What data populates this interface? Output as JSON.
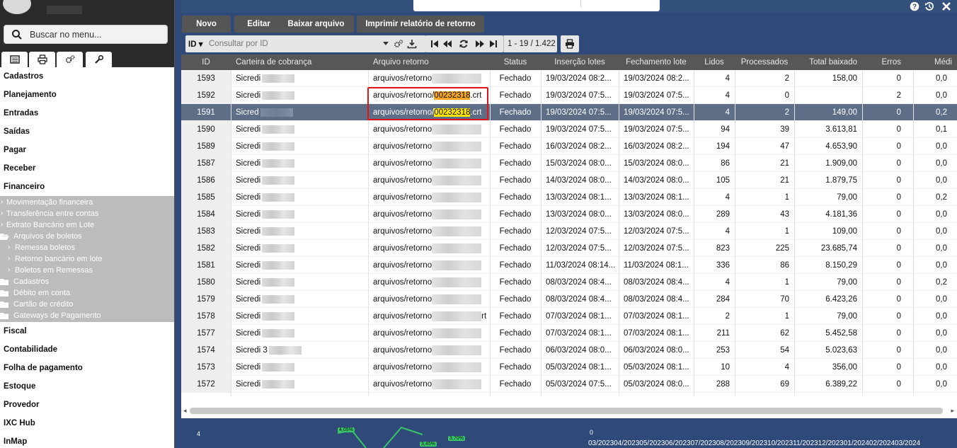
{
  "sidebar": {
    "search_placeholder": "Buscar no menu...",
    "tabs": [
      "list-icon",
      "print-icon",
      "cogs-icon",
      "wrench-icon"
    ],
    "menu_top": [
      "Cadastros",
      "Planejamento",
      "Entradas",
      "Saídas",
      "Pagar",
      "Receber",
      "Financeiro"
    ],
    "financeiro_sub": [
      {
        "label": "Movimentação financeira",
        "level": 1,
        "kind": "caret"
      },
      {
        "label": "Transferência entre contas",
        "level": 1,
        "kind": "caret"
      },
      {
        "label": "Extrato Bancário em Lote",
        "level": 1,
        "kind": "caret"
      },
      {
        "label": "Arquivos de boletos",
        "level": 1,
        "kind": "folder-open"
      },
      {
        "label": "Remessa boletos",
        "level": 2,
        "kind": "caret"
      },
      {
        "label": "Retorno bancário em lote",
        "level": 2,
        "kind": "caret"
      },
      {
        "label": "Boletos em Remessas",
        "level": 2,
        "kind": "caret"
      },
      {
        "label": "Cadastros",
        "level": 1,
        "kind": "folder"
      },
      {
        "label": "Débito em conta",
        "level": 1,
        "kind": "folder"
      },
      {
        "label": "Cartão de crédito",
        "level": 1,
        "kind": "folder"
      },
      {
        "label": "Gateways de Pagamento",
        "level": 1,
        "kind": "folder"
      }
    ],
    "menu_bottom": [
      "Fiscal",
      "Contabilidade",
      "Folha de pagamento",
      "Estoque",
      "Provedor",
      "IXC Hub",
      "InMap"
    ]
  },
  "toolbar": {
    "novo": "Novo",
    "editar": "Editar",
    "baixar": "Baixar arquivo",
    "imprimir": "Imprimir relatório de retorno"
  },
  "filter": {
    "field": "ID",
    "placeholder": "Consultar por ID",
    "page_info": "1 - 19 / 1.422"
  },
  "columns": [
    "ID",
    "Carteira de cobrança",
    "Arquivo retorno",
    "Status",
    "Inserção lotes",
    "Fechamento lote",
    "Lidos",
    "Processados",
    "Total baixado",
    "Erros",
    "Médi"
  ],
  "rows": [
    {
      "id": "1593",
      "carteira": "Sicredi",
      "arquivo": "arquivos/retorno",
      "file": "",
      "ext": "",
      "status": "Fechado",
      "insercao": "19/03/2024 08:2...",
      "fechamento": "19/03/2024 08:2...",
      "lidos": "4",
      "processados": "2",
      "total": "158,00",
      "erros": "0",
      "media": "0,0"
    },
    {
      "id": "1592",
      "carteira": "Sicredi",
      "arquivo": "arquivos/retorno/",
      "file": "00232318",
      "ext": ".crt",
      "status": "Fechado",
      "insercao": "19/03/2024 07:5...",
      "fechamento": "19/03/2024 07:5...",
      "lidos": "4",
      "processados": "0",
      "total": "",
      "erros": "2",
      "media": "0,0"
    },
    {
      "id": "1591",
      "carteira": "Sicred",
      "arquivo": "arquivos/retorno/",
      "file": "00232318",
      "ext": ".crt",
      "status": "Fechado",
      "insercao": "19/03/2024 07:5...",
      "fechamento": "19/03/2024 07:5...",
      "lidos": "4",
      "processados": "2",
      "total": "149,00",
      "erros": "0",
      "media": "0,2"
    },
    {
      "id": "1590",
      "carteira": "Sicredi",
      "arquivo": "arquivos/retorno",
      "file": "",
      "ext": "",
      "status": "Fechado",
      "insercao": "19/03/2024 07:5...",
      "fechamento": "19/03/2024 07:5...",
      "lidos": "94",
      "processados": "39",
      "total": "3.613,81",
      "erros": "0",
      "media": "0,1"
    },
    {
      "id": "1589",
      "carteira": "Sicredi",
      "arquivo": "arquivos/retorno",
      "file": "",
      "ext": "",
      "status": "Fechado",
      "insercao": "16/03/2024 08:2...",
      "fechamento": "16/03/2024 08:2...",
      "lidos": "194",
      "processados": "47",
      "total": "4.653,90",
      "erros": "0",
      "media": "0,0"
    },
    {
      "id": "1587",
      "carteira": "Sicredi",
      "arquivo": "arquivos/retorno",
      "file": "",
      "ext": "",
      "status": "Fechado",
      "insercao": "15/03/2024 08:0...",
      "fechamento": "15/03/2024 08:0...",
      "lidos": "86",
      "processados": "21",
      "total": "1.909,00",
      "erros": "0",
      "media": "0,0"
    },
    {
      "id": "1586",
      "carteira": "Sicredi",
      "arquivo": "arquivos/retorno",
      "file": "",
      "ext": "",
      "status": "Fechado",
      "insercao": "14/03/2024 08:0...",
      "fechamento": "14/03/2024 08:0...",
      "lidos": "105",
      "processados": "21",
      "total": "1.879,75",
      "erros": "0",
      "media": "0,0"
    },
    {
      "id": "1585",
      "carteira": "Sicredi",
      "arquivo": "arquivos/retorno",
      "file": "",
      "ext": "",
      "status": "Fechado",
      "insercao": "13/03/2024 08:1...",
      "fechamento": "13/03/2024 08:1...",
      "lidos": "4",
      "processados": "1",
      "total": "79,00",
      "erros": "0",
      "media": "0,2"
    },
    {
      "id": "1584",
      "carteira": "Sicredi",
      "arquivo": "arquivos/retorno",
      "file": "",
      "ext": "",
      "status": "Fechado",
      "insercao": "13/03/2024 08:0...",
      "fechamento": "13/03/2024 08:0...",
      "lidos": "289",
      "processados": "43",
      "total": "4.181,36",
      "erros": "0",
      "media": "0,0"
    },
    {
      "id": "1583",
      "carteira": "Sicredi",
      "arquivo": "arquivos/retorno",
      "file": "",
      "ext": "",
      "status": "Fechado",
      "insercao": "12/03/2024 07:5...",
      "fechamento": "12/03/2024 07:5...",
      "lidos": "4",
      "processados": "1",
      "total": "109,00",
      "erros": "0",
      "media": "0,0"
    },
    {
      "id": "1582",
      "carteira": "Sicredi",
      "arquivo": "arquivos/retorno",
      "file": "",
      "ext": "",
      "status": "Fechado",
      "insercao": "12/03/2024 07:5...",
      "fechamento": "12/03/2024 07:5...",
      "lidos": "823",
      "processados": "225",
      "total": "23.685,74",
      "erros": "0",
      "media": "0,0"
    },
    {
      "id": "1581",
      "carteira": "Sicredi",
      "arquivo": "arquivos/retorno",
      "file": "",
      "ext": "",
      "status": "Fechado",
      "insercao": "11/03/2024 08:14...",
      "fechamento": "11/03/2024 08:1...",
      "lidos": "336",
      "processados": "86",
      "total": "8.150,29",
      "erros": "0",
      "media": "0,0"
    },
    {
      "id": "1580",
      "carteira": "Sicredi",
      "arquivo": "arquivos/retorno",
      "file": "",
      "ext": "",
      "status": "Fechado",
      "insercao": "08/03/2024 08:4...",
      "fechamento": "08/03/2024 08:4...",
      "lidos": "4",
      "processados": "1",
      "total": "79,00",
      "erros": "0",
      "media": "0,2"
    },
    {
      "id": "1579",
      "carteira": "Sicredi",
      "arquivo": "arquivos/retorno",
      "file": "",
      "ext": "",
      "status": "Fechado",
      "insercao": "08/03/2024 08:4...",
      "fechamento": "08/03/2024 08:4...",
      "lidos": "284",
      "processados": "70",
      "total": "6.423,26",
      "erros": "0",
      "media": "0,0"
    },
    {
      "id": "1578",
      "carteira": "Sicredi",
      "arquivo": "arquivos/retorno",
      "file": "",
      "ext": "rt",
      "status": "Fechado",
      "insercao": "07/03/2024 08:1...",
      "fechamento": "07/03/2024 08:1...",
      "lidos": "2",
      "processados": "1",
      "total": "79,00",
      "erros": "0",
      "media": "0,0"
    },
    {
      "id": "1577",
      "carteira": "Sicredi",
      "arquivo": "arquivos/retorno",
      "file": "",
      "ext": "",
      "status": "Fechado",
      "insercao": "07/03/2024 08:1...",
      "fechamento": "07/03/2024 08:1...",
      "lidos": "211",
      "processados": "62",
      "total": "5.452,58",
      "erros": "0",
      "media": "0,0"
    },
    {
      "id": "1574",
      "carteira": "Sicredi 3",
      "arquivo": "arquivos/retorno",
      "file": "",
      "ext": "",
      "status": "Fechado",
      "insercao": "06/03/2024 08:0...",
      "fechamento": "06/03/2024 08:0...",
      "lidos": "253",
      "processados": "54",
      "total": "5.023,63",
      "erros": "0",
      "media": "0,0"
    },
    {
      "id": "1573",
      "carteira": "Sicredi",
      "arquivo": "arquivos/retorno",
      "file": "",
      "ext": "",
      "status": "Fechado",
      "insercao": "05/03/2024 08:1...",
      "fechamento": "05/03/2024 08:1...",
      "lidos": "10",
      "processados": "4",
      "total": "356,00",
      "erros": "0",
      "media": "0,0"
    },
    {
      "id": "1572",
      "carteira": "Sicredi",
      "arquivo": "arquivos/retorno",
      "file": "",
      "ext": "",
      "status": "Fechado",
      "insercao": "05/03/2024 07:5...",
      "fechamento": "05/03/2024 08:0...",
      "lidos": "288",
      "processados": "69",
      "total": "6.389,22",
      "erros": "0",
      "media": "0,0"
    }
  ],
  "background_chart": {
    "left_number": "4",
    "zero_label": "0",
    "dates": "03/202304/202305/202306/202307/202308/202309/202310/202311/202312/202301/202402/202403/2024",
    "pct": [
      "4,05%",
      "3,70%",
      "3,45%"
    ]
  },
  "colors": {
    "selected_row": "#5e6e87",
    "header": "#575757",
    "highlight_orange": "#f5a623",
    "highlight_yellow": "#ffe600",
    "annotation_red": "#e0141b",
    "main_bg": "#2f4a78"
  }
}
